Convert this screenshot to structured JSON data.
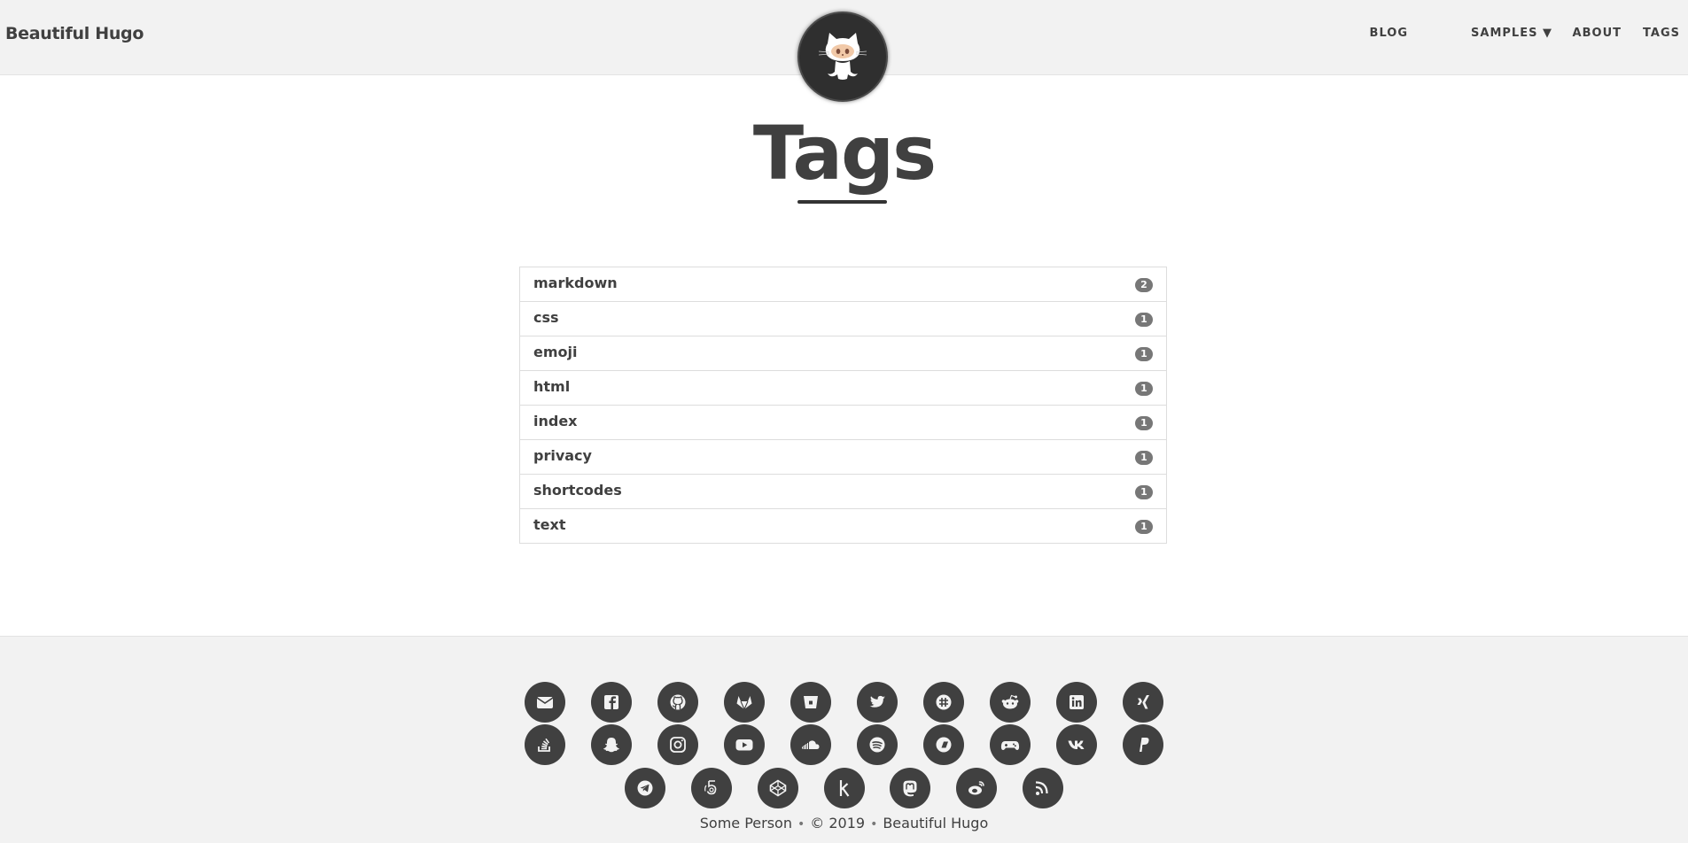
{
  "navbar": {
    "brand": "Beautiful Hugo",
    "links": [
      "BLOG",
      "SAMPLES ▼",
      "ABOUT",
      "TAGS"
    ]
  },
  "avatar": {
    "icon": "github-octocat-icon"
  },
  "page": {
    "title": "Tags"
  },
  "tags": [
    {
      "name": "markdown",
      "count": "2"
    },
    {
      "name": "css",
      "count": "1"
    },
    {
      "name": "emoji",
      "count": "1"
    },
    {
      "name": "html",
      "count": "1"
    },
    {
      "name": "index",
      "count": "1"
    },
    {
      "name": "privacy",
      "count": "1"
    },
    {
      "name": "shortcodes",
      "count": "1"
    },
    {
      "name": "text",
      "count": "1"
    }
  ],
  "footer": {
    "social_icons": [
      "email-icon",
      "facebook-icon",
      "github-icon",
      "gitlab-icon",
      "bitbucket-icon",
      "twitter-icon",
      "slack-icon",
      "reddit-icon",
      "linkedin-icon",
      "xing-icon",
      "stackoverflow-icon",
      "snapchat-icon",
      "instagram-icon",
      "youtube-icon",
      "soundcloud-icon",
      "spotify-icon",
      "bandcamp-icon",
      "gamepad-icon",
      "vk-icon",
      "paypal-icon",
      "telegram-icon",
      "500px-icon",
      "codepen-icon",
      "kaggle-icon",
      "mastodon-icon",
      "weibo-icon",
      "rss-icon"
    ],
    "author": "Some Person",
    "copyright": "© 2019",
    "site": "Beautiful Hugo"
  },
  "colors": {
    "navbar_bg": "#f2f2f2",
    "text": "#404040",
    "badge": "#777777",
    "icon_circle": "#404040"
  }
}
